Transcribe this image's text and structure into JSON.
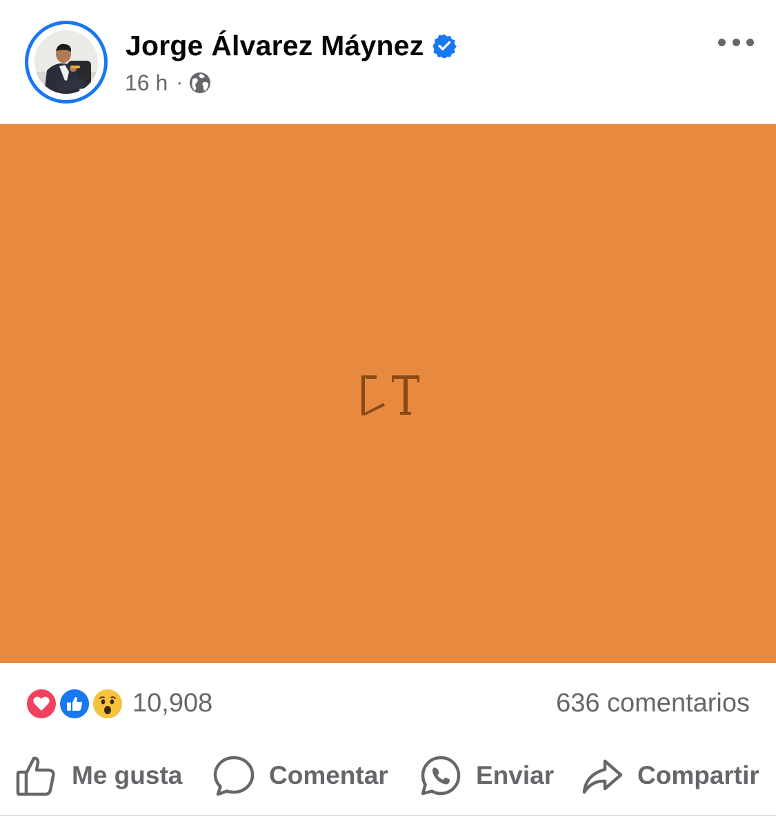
{
  "post": {
    "author_name": "Jorge Álvarez Máynez",
    "verified": true,
    "time": "16 h",
    "separator": "·",
    "audience_icon": "globe-icon",
    "more_icon": "more-options-icon"
  },
  "media": {
    "background_color": "#e78a3f",
    "logo_color": "#8a4a14"
  },
  "stats": {
    "reactions": [
      "love",
      "like",
      "wow"
    ],
    "reaction_count": "10,908",
    "comment_count": "636 comentarios"
  },
  "actions": {
    "like_label": "Me gusta",
    "comment_label": "Comentar",
    "send_label": "Enviar",
    "share_label": "Compartir"
  },
  "colors": {
    "accent": "#1877f2",
    "secondary_text": "#65676b",
    "primary_text": "#050505"
  }
}
